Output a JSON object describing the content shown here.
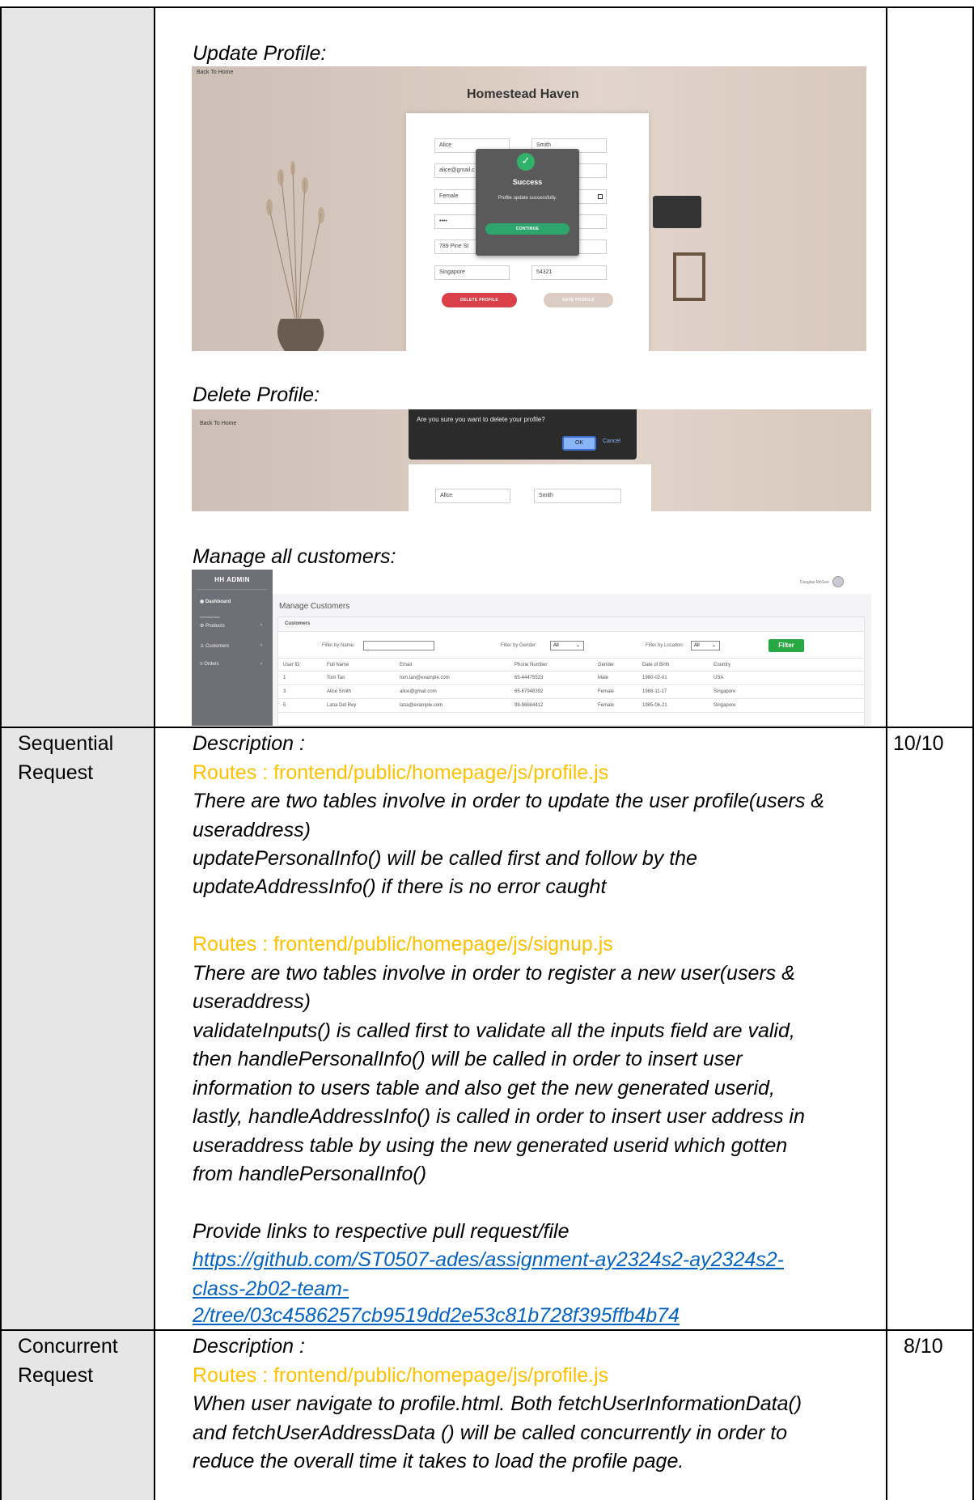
{
  "row1": {
    "update_profile_title": "Update Profile:",
    "update_shot": {
      "back_link": "Back To Home",
      "brand": "Homestead Haven",
      "fields": {
        "first_name": "Alice",
        "last_name": "Smith",
        "email": "alice@gmail.c",
        "gender": "Female",
        "password": "••••",
        "address": "789 Pine St",
        "country": "Singapore",
        "postal": "54321"
      },
      "delete_button": "DELETE PROFILE",
      "save_button": "SAVE PROFILE",
      "dialog": {
        "title": "Success",
        "message": "Profile update successfully.",
        "continue": "CONTINUE"
      }
    },
    "delete_profile_title": "Delete Profile:",
    "delete_shot": {
      "back_link": "Back To Home",
      "confirm_text": "Are you sure you want to delete your profile?",
      "ok": "OK",
      "cancel": "Cancel",
      "first_name": "Alice",
      "last_name": "Smith"
    },
    "manage_title": "Manage all customers:",
    "admin_shot": {
      "brand": "HH ADMIN",
      "nav": {
        "dashboard": "Dashboard",
        "section": "Administration",
        "products": "Products",
        "customers": "Customers",
        "orders": "Orders"
      },
      "user_name": "Douglas McGee",
      "page_title": "Manage Customers",
      "card_title": "Customers",
      "filter_name_label": "Filter by Name:",
      "filter_gender_label": "Filter by Gender:",
      "filter_gender_value": "All",
      "filter_location_label": "Filter by Location:",
      "filter_location_value": "All",
      "filter_button": "Filter",
      "columns": [
        "User ID",
        "Full Name",
        "Email",
        "Phone Number",
        "Gender",
        "Date of Birth",
        "Country"
      ],
      "rows": [
        [
          "1",
          "Tom Tan",
          "tom.tan@example.com",
          "65-44475523",
          "Male",
          "1980-02-01",
          "USA"
        ],
        [
          "3",
          "Alice Smith",
          "alice@gmail.com",
          "65-67948392",
          "Female",
          "1988-11-17",
          "Singapore"
        ],
        [
          "5",
          "Lana Del Rey",
          "lana@example.com",
          "99-98684412",
          "Female",
          "1985-06-21",
          "Singapore"
        ]
      ]
    }
  },
  "row2": {
    "criteria": [
      "Sequential",
      "Request"
    ],
    "score": "10/10",
    "lines": {
      "desc": "Description :",
      "route1": "Routes : frontend/public/homepage/js/profile.js",
      "p1_l1": "There are two tables involve in order to update the user profile(users &",
      "p1_l2": "useraddress)",
      "p1_l3": "updatePersonalInfo() will be called first and follow by the",
      "p1_l4": "updateAddressInfo() if there is no error caught",
      "route2": "Routes : frontend/public/homepage/js/signup.js",
      "p2_l1": "There are two tables involve in order to register a new user(users &",
      "p2_l2": "useraddress)",
      "p2_l3": "validateInputs() is called first to validate all the inputs field are valid,",
      "p2_l4": "then handlePersonalInfo() will be called in order to insert user",
      "p2_l5": "information to users table and also get the new generated userid,",
      "p2_l6": "lastly, handleAddressInfo() is called in order to insert user address in",
      "p2_l7": "useraddress table by using the new generated userid which gotten",
      "p2_l8": "from handlePersonalInfo()",
      "links_label": "Provide links to respective pull request/file",
      "link_l1": "https://github.com/ST0507-ades/assignment-ay2324s2-ay2324s2-",
      "link_l2": "class-2b02-team-",
      "link_l3": "2/tree/03c4586257cb9519dd2e53c81b728f395ffb4b74"
    }
  },
  "row3": {
    "criteria": [
      "Concurrent",
      "Request"
    ],
    "score": "8/10",
    "lines": {
      "desc": "Description :",
      "route": "Routes : frontend/public/homepage/js/profile.js",
      "l1": "When user navigate to profile.html. Both fetchUserInformationData()",
      "l2": "and fetchUserAddressData () will be called concurrently in order to",
      "l3": "reduce the overall time it takes to load the profile page."
    }
  },
  "colors": {
    "criteria_shade": "#e7e6e6",
    "route_orange": "#ffc000",
    "link_blue": "#0563c1"
  }
}
